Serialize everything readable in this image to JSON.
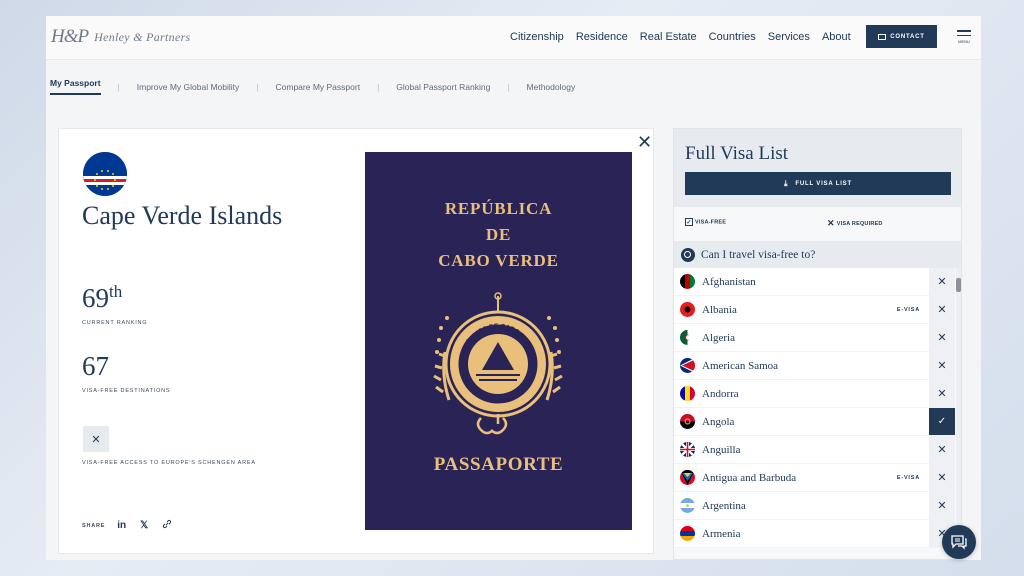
{
  "header": {
    "logo_mark": "H&P",
    "logo_text": "Henley & Partners",
    "nav": [
      "Citizenship",
      "Residence",
      "Real Estate",
      "Countries",
      "Services",
      "About"
    ],
    "contact_label": "CONTACT",
    "menu_label": "MENU"
  },
  "subnav": {
    "items": [
      "My Passport",
      "Improve My Global Mobility",
      "Compare My Passport",
      "Global Passport Ranking",
      "Methodology"
    ],
    "active": "My Passport"
  },
  "passport_card": {
    "country": "Cape Verde Islands",
    "ranking_number": "69",
    "ranking_suffix": "th",
    "ranking_caption": "CURRENT RANKING",
    "visa_free_count": "67",
    "visa_free_caption": "VISA-FREE DESTINATIONS",
    "schengen_caption": "VISA-FREE ACCESS TO EUROPE'S SCHENGEN AREA",
    "schengen_status": "✕",
    "share_label": "SHARE",
    "share_icons": [
      "linkedin-icon",
      "x-icon",
      "link-icon"
    ],
    "close_symbol": "✕",
    "passport_cover": {
      "line1": "REPÚBLICA",
      "line2": "DE",
      "line3": "CABO VERDE",
      "seal_text": "REPÚBLICA DE CABO VERDE",
      "footer": "PASSAPORTE",
      "cover_color": "#2a2356",
      "ink_color": "#e9bf7c"
    }
  },
  "visa_panel": {
    "title": "Full Visa List",
    "download_label": "FULL VISA LIST",
    "legend_visa_free": "VISA-FREE",
    "legend_visa_required": "VISA REQUIRED",
    "search_placeholder": "Can I travel visa-free to?",
    "countries": [
      {
        "name": "Afghanistan",
        "tag": "",
        "status": "required"
      },
      {
        "name": "Albania",
        "tag": "E-VISA",
        "status": "required"
      },
      {
        "name": "Algeria",
        "tag": "",
        "status": "required"
      },
      {
        "name": "American Samoa",
        "tag": "",
        "status": "required"
      },
      {
        "name": "Andorra",
        "tag": "",
        "status": "required"
      },
      {
        "name": "Angola",
        "tag": "",
        "status": "free"
      },
      {
        "name": "Anguilla",
        "tag": "",
        "status": "required"
      },
      {
        "name": "Antigua and Barbuda",
        "tag": "E-VISA",
        "status": "required"
      },
      {
        "name": "Argentina",
        "tag": "",
        "status": "required"
      },
      {
        "name": "Armenia",
        "tag": "",
        "status": "required"
      }
    ]
  },
  "colors": {
    "navy": "#213a58",
    "background": "#f4f5f7"
  }
}
